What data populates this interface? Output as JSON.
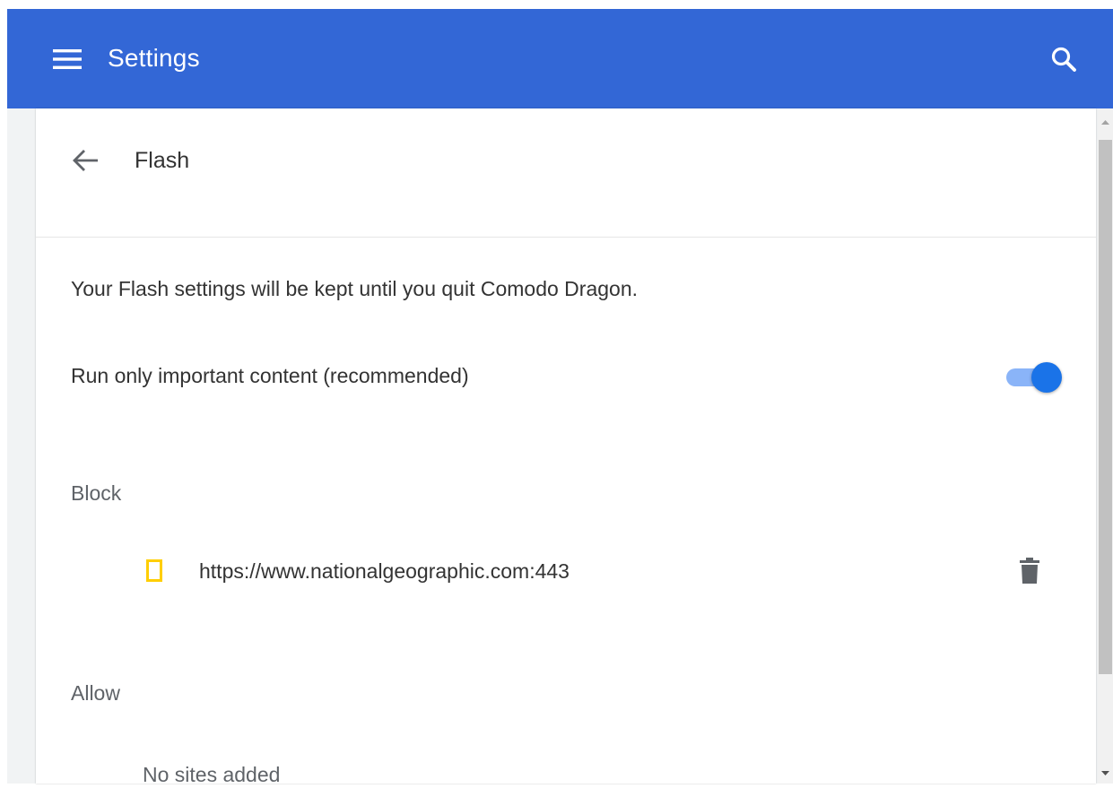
{
  "toolbar": {
    "title": "Settings",
    "menu_icon": "hamburger-menu-icon",
    "search_icon": "search-icon",
    "background_color": "#3367d6"
  },
  "page": {
    "title": "Flash",
    "back_icon": "arrow-back-icon",
    "info_text": "Your Flash settings will be kept until you quit Comodo Dragon."
  },
  "toggle": {
    "label": "Run only important content (recommended)",
    "state": "on",
    "accent_color": "#1a73e8"
  },
  "block": {
    "heading": "Block",
    "sites": [
      {
        "url": "https://www.nationalgeographic.com:443",
        "favicon_color": "#ffce00",
        "remove_icon": "trash-icon"
      }
    ]
  },
  "allow": {
    "heading": "Allow",
    "empty_text": "No sites added"
  }
}
